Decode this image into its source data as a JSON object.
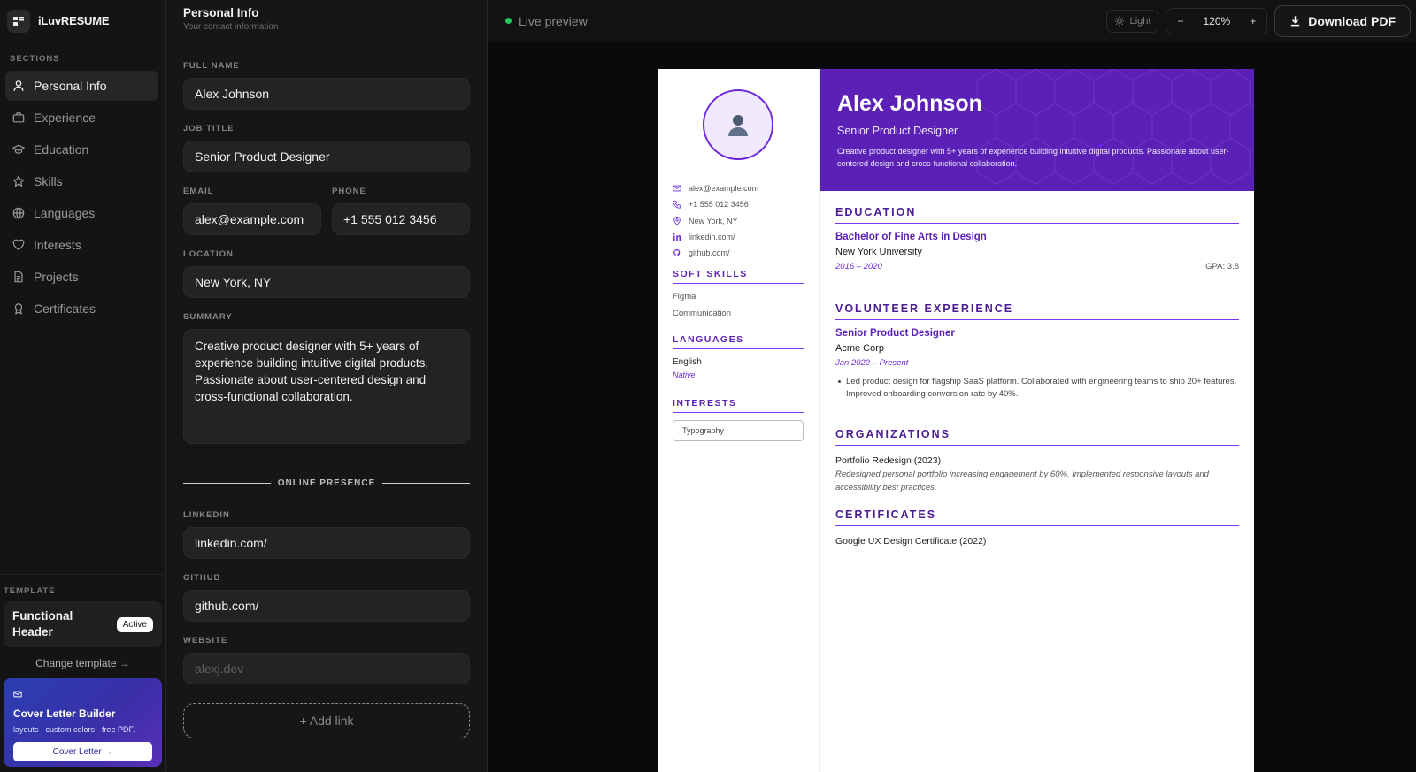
{
  "brand": {
    "name": "iLuvRESUME"
  },
  "sidebar": {
    "section_label": "SECTIONS",
    "items": [
      {
        "label": "Personal Info",
        "icon": "user-icon",
        "active": true
      },
      {
        "label": "Experience",
        "icon": "briefcase-icon"
      },
      {
        "label": "Education",
        "icon": "graduation-cap-icon"
      },
      {
        "label": "Skills",
        "icon": "star-icon"
      },
      {
        "label": "Languages",
        "icon": "globe-icon"
      },
      {
        "label": "Interests",
        "icon": "heart-icon"
      },
      {
        "label": "Projects",
        "icon": "document-icon"
      },
      {
        "label": "Certificates",
        "icon": "award-icon"
      }
    ],
    "template_label": "TEMPLATE",
    "template_name": "Functional Header",
    "template_badge": "Active",
    "change_template": "Change template →",
    "cover": {
      "title": "Cover Letter Builder",
      "subtitle": "layouts · custom colors · free PDF.",
      "button": "Cover Letter →"
    }
  },
  "editor": {
    "title": "Personal Info",
    "subtitle": "Your contact information",
    "full_name": {
      "label": "FULL NAME",
      "value": "Alex Johnson"
    },
    "job_title": {
      "label": "JOB TITLE",
      "value": "Senior Product Designer"
    },
    "email": {
      "label": "EMAIL",
      "value": "alex@example.com"
    },
    "phone": {
      "label": "PHONE",
      "value": "+1 555 012 3456"
    },
    "location": {
      "label": "LOCATION",
      "value": "New York, NY"
    },
    "summary": {
      "label": "SUMMARY",
      "value": "Creative product designer with 5+ years of experience building intuitive digital products. Passionate about user-centered design and cross-functional collaboration."
    },
    "online_presence": "ONLINE PRESENCE",
    "linkedin": {
      "label": "LINKEDIN",
      "value": "linkedin.com/"
    },
    "github": {
      "label": "GITHUB",
      "value": "github.com/"
    },
    "website": {
      "label": "WEBSITE",
      "placeholder": "alexj.dev"
    },
    "add_link": "+ Add link"
  },
  "preview": {
    "status": "Live preview",
    "theme_label": "Light",
    "zoom_minus": "−",
    "zoom_value": "120%",
    "zoom_plus": "+",
    "download": "Download PDF"
  },
  "resume": {
    "name": "Alex Johnson",
    "title": "Senior Product Designer",
    "summary": "Creative product designer with 5+ years of experience building intuitive digital products. Passionate about user-centered design and cross-functional collaboration.",
    "contacts": {
      "email": "alex@example.com",
      "phone": "+1 555 012 3456",
      "location": "New York, NY",
      "linkedin": "linkedin.com/",
      "github": "github.com/"
    },
    "soft_skills": {
      "heading": "SOFT SKILLS",
      "items": [
        "Figma",
        "Communication"
      ]
    },
    "languages": {
      "heading": "LANGUAGES",
      "name": "English",
      "level": "Native"
    },
    "interests": {
      "heading": "INTERESTS",
      "items": [
        "Typography"
      ]
    },
    "education": {
      "heading": "EDUCATION",
      "degree": "Bachelor of Fine Arts in Design",
      "school": "New York University",
      "dates": "2016 – 2020",
      "gpa": "GPA: 3.8"
    },
    "volunteer": {
      "heading": "VOLUNTEER EXPERIENCE",
      "role": "Senior Product Designer",
      "org": "Acme Corp",
      "dates": "Jan 2022 – Present",
      "bullet": "Led product design for flagship SaaS platform. Collaborated with engineering teams to ship 20+ features. Improved onboarding conversion rate by 40%."
    },
    "organizations": {
      "heading": "ORGANIZATIONS",
      "name": "Portfolio Redesign (2023)",
      "desc": "Redesigned personal portfolio increasing engagement by 60%. Implemented responsive layouts and accessibility best practices."
    },
    "certificates": {
      "heading": "CERTIFICATES",
      "item": "Google UX Design Certificate (2022)"
    }
  },
  "colors": {
    "accent": "#5b21b6",
    "accent_line": "#7c3aed",
    "live": "#22c55e"
  }
}
